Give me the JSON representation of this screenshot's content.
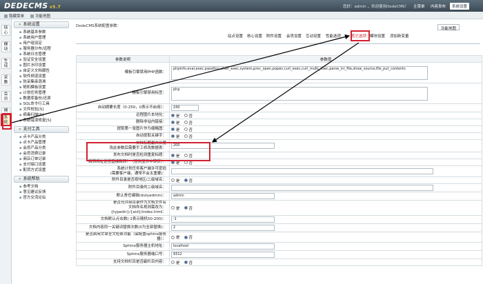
{
  "header": {
    "logo": "DEDECMS",
    "version": "v5.7",
    "welcome": "您好：admin ，欢迎使用DedeCMS！",
    "links": [
      "主菜单",
      "内容发布",
      "系统设置"
    ],
    "active_link": "系统设置"
  },
  "subbar": {
    "items": [
      "隐藏菜单",
      "功能地图"
    ],
    "func_map": "功能地图"
  },
  "left_tabs": [
    "核心",
    "模块",
    "生成",
    "采集",
    "会员",
    "模板",
    "系统"
  ],
  "left_tab_selected": "系统",
  "side_menu": [
    {
      "title": "系统设置",
      "items": [
        "系统基本参数",
        "系统用户管理",
        "用户组设定",
        "服务器分布/远程",
        "系统日志管理",
        "验证安全设置",
        "图片水印设置",
        "自定义文档属性",
        "软件频道设置",
        "防采集串混淆",
        "随机模板设置",
        "计划任务管理",
        "数据库备份/还原",
        "SQL命令行工具",
        "文件校验[S]",
        "病毒扫描[S]",
        "系统错误修复[S]"
      ]
    },
    {
      "title": "支付工具",
      "items": [
        "点卡产品分类",
        "点卡产品管理",
        "会员产品分类",
        "会员消费记录",
        "商店订单记录",
        "支付接口设置",
        "配货方式设置"
      ]
    },
    {
      "title": "系统帮助",
      "items": [
        "参考文档",
        "意见建议反馈",
        "官方交流论坛"
      ]
    }
  ],
  "main": {
    "breadcrumb": "DedeCMS系统配置参数：",
    "tabs": [
      "站点设置",
      "核心设置",
      "附件设置",
      "会员设置",
      "互动设置",
      "性能选项",
      "其它选项",
      "模块设置",
      "添加新变量"
    ],
    "selected_tab": "其它选项",
    "col_headers": [
      "参数说明",
      "参数值"
    ],
    "rows": [
      {
        "label": "模板引擎禁用PHP函数：",
        "type": "textarea",
        "value": "phpinfo,eval,exec,passthru,shell_exec,system,proc_open,popen,curl_exec,curl_multi_exec,parse_ini_file,show_source,file_put_contents"
      },
      {
        "label": "模板引擎禁用标签：",
        "type": "textarea",
        "value": "php"
      },
      {
        "label": "自动摘要长度（0-250，0表示不启用）：",
        "type": "text",
        "value": "240"
      },
      {
        "label": "远程图片本地化：",
        "type": "radio",
        "value": "是"
      },
      {
        "label": "删除非站内链接：",
        "type": "radio",
        "value": "是"
      },
      {
        "label": "提取第一张图片作为缩略图：",
        "type": "radio",
        "value": "是"
      },
      {
        "label": "自动提取关键字：",
        "type": "radio",
        "value": "是"
      },
      {
        "label": "文档标题最大长度\n改此参数后需要手工修改数据表：",
        "type": "text",
        "value": "200"
      },
      {
        "label": "发布文档时是否检测重复标题：",
        "type": "radio",
        "value": "是"
      },
      {
        "label": "跳转网址是否直接跳转？（否则显示中转页）：",
        "type": "radio",
        "value": "是"
      },
      {
        "label": "系统计划任务客户端许可密码\n(需要客户端，通常不会太重要)：",
        "type": "text",
        "value": ""
      },
      {
        "label": "附件目录是否按地区/二级域名：",
        "type": "radio",
        "value": "否"
      },
      {
        "label": "附件目录的二级域名：",
        "type": "text",
        "value": ""
      },
      {
        "label": "默认责任编辑(dutyadmin)：",
        "type": "text",
        "value": "admin"
      },
      {
        "label": "是否允许用目录作为文档文件名\n文档命名规则需改为：{typedir}/{aid}/index.html：",
        "type": "radio",
        "value": "否"
      },
      {
        "label": "文档默认点击数(-1表示随机50-200)：",
        "type": "text",
        "value": "-1"
      },
      {
        "label": "文档内容同一关键词替换次数(0为全部替换)：",
        "type": "text",
        "value": "2"
      },
      {
        "label": "是否启用文章全文检索功能（需配置sphinx服务器）：",
        "type": "radio",
        "value": "否"
      },
      {
        "label": "Sphinx服务器主机地址：",
        "type": "text",
        "value": "localhost"
      },
      {
        "label": "Sphinx服务器端口号：",
        "type": "text",
        "value": "9312"
      },
      {
        "label": "支持文档栏目是否副栏目内容：",
        "type": "radio",
        "value": "否"
      }
    ],
    "radio_yes": "是",
    "radio_no": "否"
  },
  "colors": {
    "highlight": "#d21f2f",
    "topbar": "#3c4a55"
  }
}
